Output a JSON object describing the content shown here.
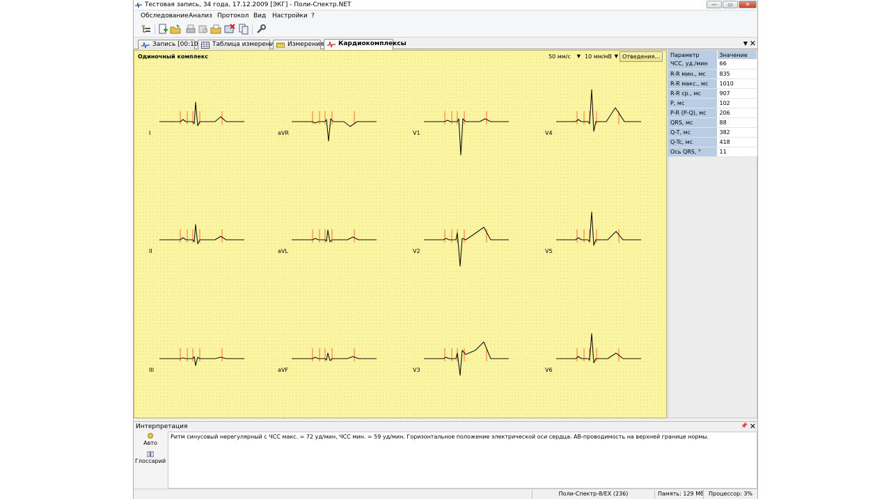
{
  "window": {
    "title": "Тестовая запись, 34 года, 17.12.2009 [ЭКГ] - Поли-Спектр.NET"
  },
  "menu": [
    "Обследование",
    "Анализ",
    "Протокол",
    "Вид",
    "Настройки",
    "?"
  ],
  "toolbar_icons": [
    "tree-view-icon",
    "new-record-icon",
    "open-icon",
    "print-icon",
    "print-preview-icon",
    "export-icon",
    "delete-icon",
    "copy-icon",
    "tools-icon"
  ],
  "tabs": [
    {
      "label": "Запись [00:10]",
      "icon": "ecg-record-icon"
    },
    {
      "label": "Таблица измерений",
      "icon": "table-icon"
    },
    {
      "label": "Измерения",
      "icon": "measure-icon"
    },
    {
      "label": "Кардиокомплексы",
      "icon": "cardio-icon",
      "active": true
    }
  ],
  "ecg_panel": {
    "title": "Одиночный комплекс",
    "speed": "50 мм/с",
    "gain": "10 мм/мВ",
    "leads_button": "Отведения...",
    "background": "#fbf5a1",
    "leads": [
      "I",
      "aVR",
      "V1",
      "V4",
      "II",
      "aVL",
      "V2",
      "V5",
      "III",
      "aVF",
      "V3",
      "V6"
    ]
  },
  "params": {
    "header_name": "Параметр",
    "header_value": "Значение",
    "rows": [
      {
        "name": "ЧСС, уд./мин",
        "value": "66"
      },
      {
        "name": "R-R мин., мс",
        "value": "835"
      },
      {
        "name": "R-R макс., мс",
        "value": "1010"
      },
      {
        "name": "R-R ср., мс",
        "value": "907"
      },
      {
        "name": "P, мс",
        "value": "102"
      },
      {
        "name": "P-R (P-Q), мс",
        "value": "206"
      },
      {
        "name": "QRS, мс",
        "value": "88"
      },
      {
        "name": "Q-T, мс",
        "value": "382"
      },
      {
        "name": "Q-Tc, мс",
        "value": "418"
      },
      {
        "name": "Ось QRS, °",
        "value": "11"
      }
    ]
  },
  "interpretation": {
    "title": "Интерпретация",
    "auto_label": "Авто",
    "glossary_label": "Глоссарий",
    "text": "Ритм синусовый нерегулярный с ЧСС макс. = 72 уд/мин, ЧСС мин. = 59 уд/мин. Горизонтальное положение электрической оси сердца. АВ-проводимость на верхней границе нормы."
  },
  "status": {
    "device": "Поли-Спектр-8/EX (236)",
    "memory": "Память: 129 Мб",
    "cpu": "Процессор: 3%"
  },
  "colors": {
    "ecg_bg": "#fbf5a1",
    "param_header": "#b9cde5",
    "marker": "#ff5a2a"
  }
}
